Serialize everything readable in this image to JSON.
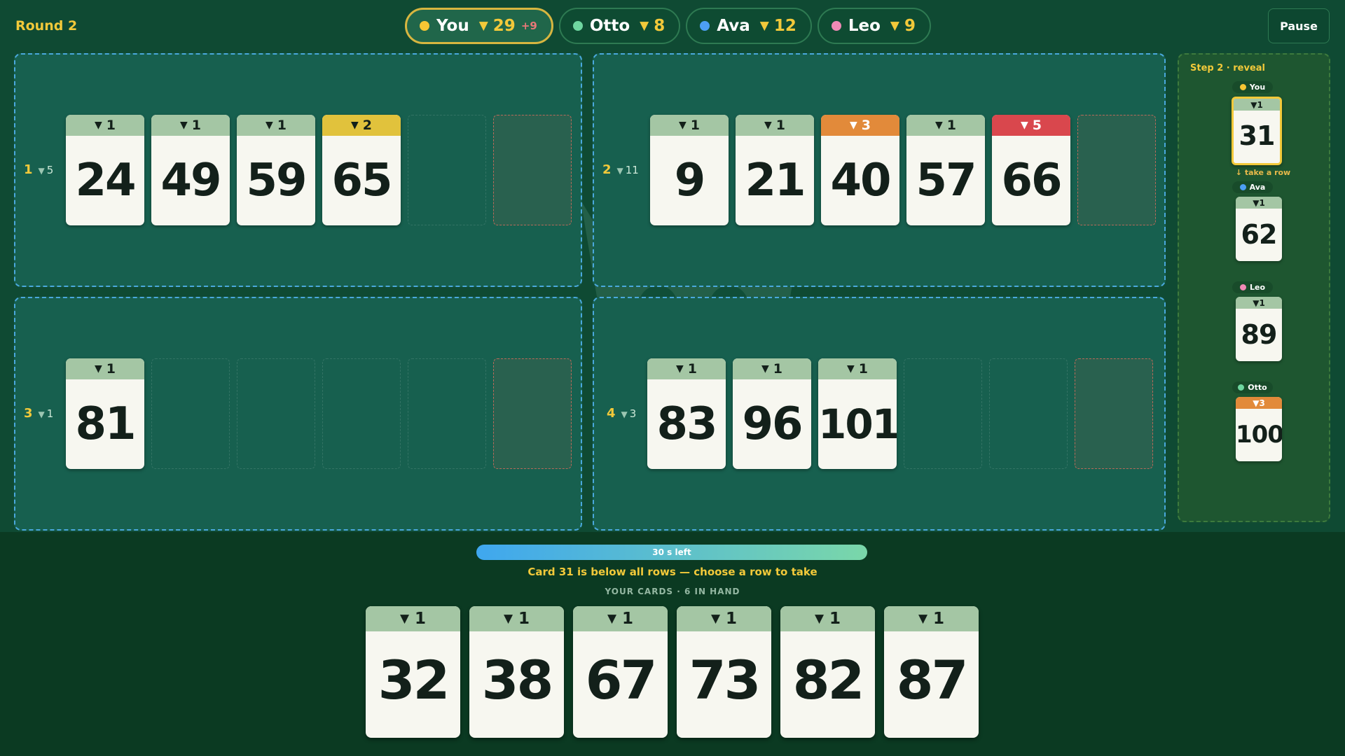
{
  "round": "Round 2",
  "players": [
    {
      "name": "You",
      "color": "#f6c634",
      "score": "29",
      "delta": "+9",
      "active": true
    },
    {
      "name": "Otto",
      "color": "#6fd6a0",
      "score": "8"
    },
    {
      "name": "Ava",
      "color": "#4d9ff3",
      "score": "12"
    },
    {
      "name": "Leo",
      "color": "#f08ab6",
      "score": "9"
    }
  ],
  "pause_label": "Pause",
  "rows": [
    {
      "id": "1",
      "bulls": "5",
      "cards": [
        {
          "value": "24",
          "bulls": "1",
          "color": "#a4c6a4"
        },
        {
          "value": "49",
          "bulls": "1",
          "color": "#a4c6a4"
        },
        {
          "value": "59",
          "bulls": "1",
          "color": "#a4c6a4"
        },
        {
          "value": "65",
          "bulls": "2",
          "color": "#e1c23c"
        }
      ]
    },
    {
      "id": "2",
      "bulls": "11",
      "cards": [
        {
          "value": "9",
          "bulls": "1",
          "color": "#a4c6a4"
        },
        {
          "value": "21",
          "bulls": "1",
          "color": "#a4c6a4"
        },
        {
          "value": "40",
          "bulls": "3",
          "color": "#e28a3a"
        },
        {
          "value": "57",
          "bulls": "1",
          "color": "#a4c6a4"
        },
        {
          "value": "66",
          "bulls": "5",
          "color": "#d9474d"
        }
      ]
    },
    {
      "id": "3",
      "bulls": "1",
      "cards": [
        {
          "value": "81",
          "bulls": "1",
          "color": "#a4c6a4"
        }
      ]
    },
    {
      "id": "4",
      "bulls": "3",
      "cards": [
        {
          "value": "83",
          "bulls": "1",
          "color": "#a4c6a4"
        },
        {
          "value": "96",
          "bulls": "1",
          "color": "#a4c6a4"
        },
        {
          "value": "101",
          "bulls": "1",
          "color": "#a4c6a4"
        }
      ]
    }
  ],
  "reveal": {
    "title": "Step 2 · reveal",
    "take_note": "↓ take a row",
    "plays": [
      {
        "player": "You",
        "color": "#f6c634",
        "value": "31",
        "bulls": "1",
        "head_color": "#a4c6a4",
        "selected": true
      },
      {
        "player": "Ava",
        "color": "#4d9ff3",
        "value": "62",
        "bulls": "1",
        "head_color": "#a4c6a4"
      },
      {
        "player": "Leo",
        "color": "#f08ab6",
        "value": "89",
        "bulls": "1",
        "head_color": "#a4c6a4"
      },
      {
        "player": "Otto",
        "color": "#6fd6a0",
        "value": "100",
        "bulls": "3",
        "head_color": "#e28a3a"
      }
    ]
  },
  "timer": {
    "label": "30 s left",
    "fraction": 1.0
  },
  "message": "Card 31 is below all rows — choose a row to take",
  "hand_label": "YOUR CARDS · 6 IN HAND",
  "hand": [
    {
      "value": "32",
      "bulls": "1"
    },
    {
      "value": "38",
      "bulls": "1"
    },
    {
      "value": "67",
      "bulls": "1"
    },
    {
      "value": "73",
      "bulls": "1"
    },
    {
      "value": "82",
      "bulls": "1"
    },
    {
      "value": "87",
      "bulls": "1"
    }
  ],
  "icons": {
    "bull": "bull-head-icon",
    "player_marker": "dot-icon"
  }
}
